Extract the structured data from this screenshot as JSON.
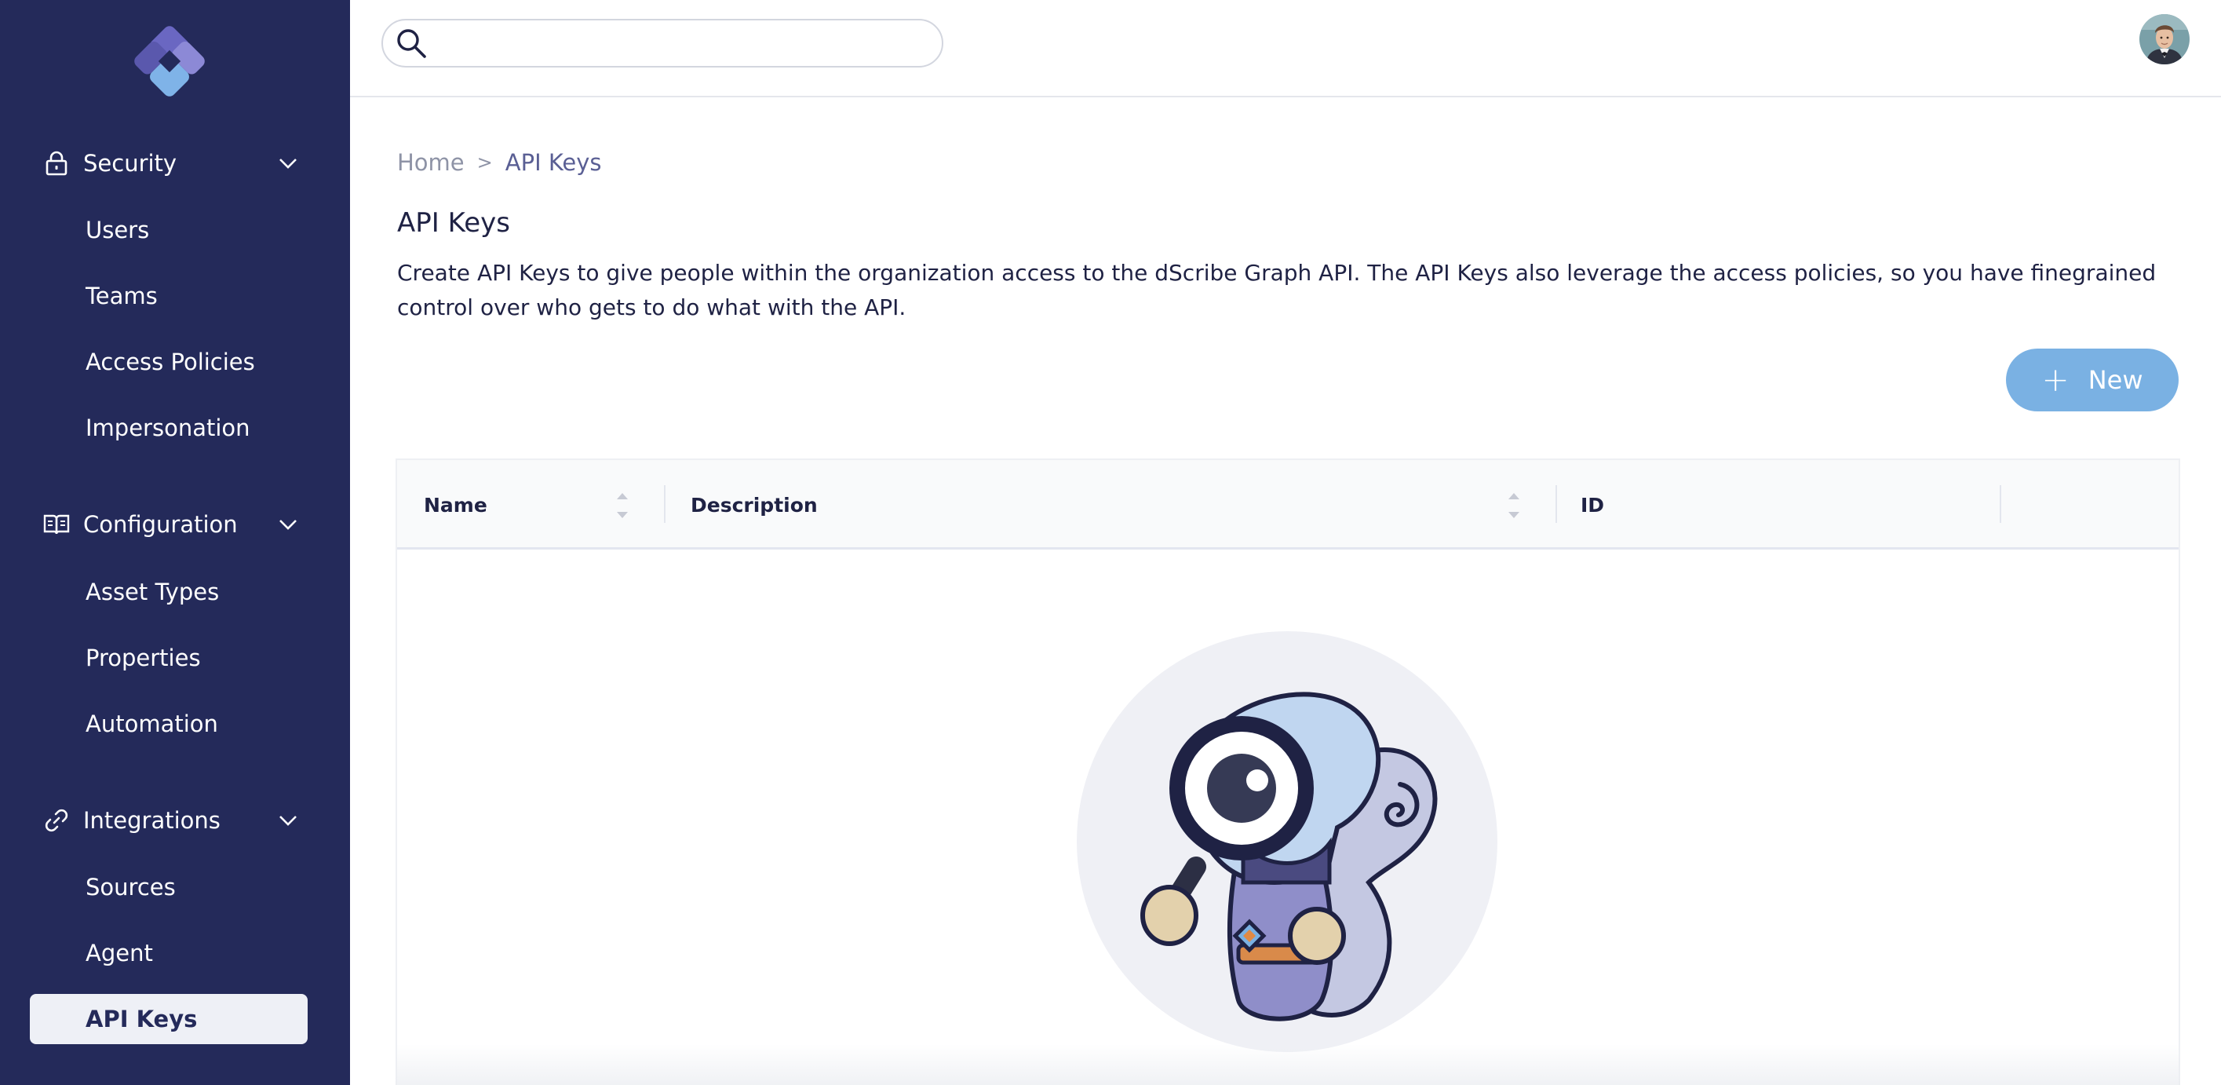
{
  "sidebar": {
    "sections": [
      {
        "label": "Security",
        "icon": "lock-icon",
        "items": [
          {
            "label": "Users"
          },
          {
            "label": "Teams"
          },
          {
            "label": "Access Policies"
          },
          {
            "label": "Impersonation"
          }
        ]
      },
      {
        "label": "Configuration",
        "icon": "book-icon",
        "items": [
          {
            "label": "Asset Types"
          },
          {
            "label": "Properties"
          },
          {
            "label": "Automation"
          }
        ]
      },
      {
        "label": "Integrations",
        "icon": "link-icon",
        "items": [
          {
            "label": "Sources"
          },
          {
            "label": "Agent"
          },
          {
            "label": "API Keys",
            "active": true
          }
        ]
      }
    ]
  },
  "header": {
    "search_placeholder": "",
    "search_value": ""
  },
  "breadcrumb": {
    "home": "Home",
    "separator": ">",
    "current": "API Keys"
  },
  "page": {
    "title": "API Keys",
    "description": "Create API Keys to give people within the organization access to the dScribe Graph API. The API Keys also leverage the access policies, so you have finegrained control over who gets to do what with the API."
  },
  "actions": {
    "new_label": "New",
    "new_icon": "+"
  },
  "table": {
    "columns": [
      {
        "label": "Name",
        "sortable": true
      },
      {
        "label": "Description",
        "sortable": true
      },
      {
        "label": "ID",
        "sortable": false
      }
    ],
    "rows": []
  },
  "colors": {
    "sidebar_bg": "#242a5a",
    "active_item_bg": "#eef0f6",
    "primary_button": "#7ab1e3",
    "breadcrumb_current": "#5a5f94"
  }
}
